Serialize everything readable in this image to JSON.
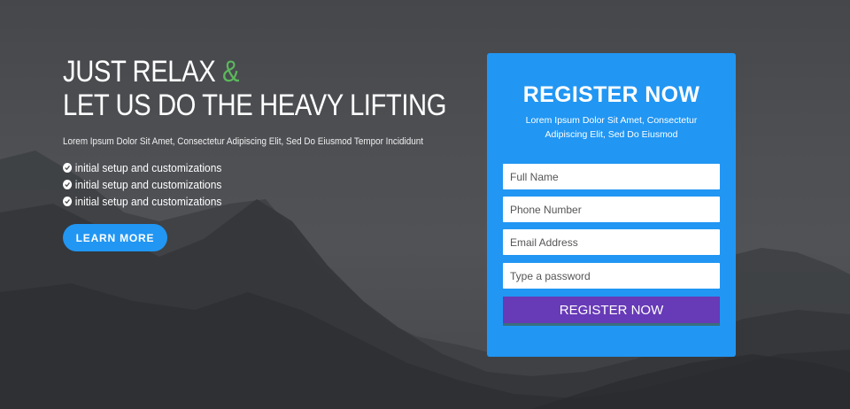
{
  "hero": {
    "headline_line1": "JUST RELAX",
    "headline_amp": "&",
    "headline_line2": "LET US DO THE HEAVY LIFTING",
    "subtitle": "Lorem Ipsum Dolor Sit Amet, Consectetur Adipiscing Elit, Sed Do Eiusmod Tempor Incididunt",
    "features": [
      {
        "icon": "check-circle-icon",
        "label": "initial setup and customizations"
      },
      {
        "icon": "check-circle-icon",
        "label": "initial setup and customizations"
      },
      {
        "icon": "check-circle-icon",
        "label": "initial setup and customizations"
      }
    ],
    "learn_more_label": "LEARN MORE"
  },
  "register": {
    "title": "REGISTER NOW",
    "subtitle": "Lorem Ipsum Dolor Sit Amet, Consectetur Adipiscing Elit, Sed Do Eiusmod",
    "fields": {
      "full_name": {
        "placeholder": "Full Name",
        "value": ""
      },
      "phone": {
        "placeholder": "Phone Number",
        "value": ""
      },
      "email": {
        "placeholder": "Email Address",
        "value": ""
      },
      "password": {
        "placeholder": "Type a password",
        "value": ""
      }
    },
    "submit_label": "REGISTER NOW"
  },
  "colors": {
    "accent": "#2196f3",
    "amp_green": "#5cb85c",
    "submit_purple": "#673ab7",
    "background_dark": "#4a4c50"
  }
}
